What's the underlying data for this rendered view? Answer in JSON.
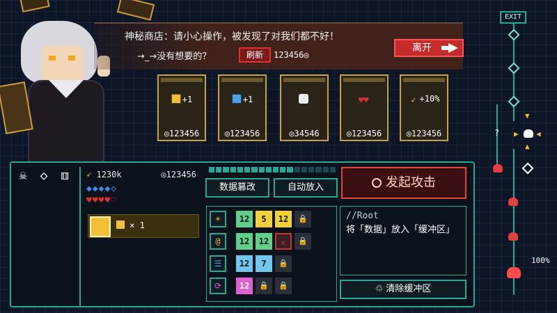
{
  "shop": {
    "message": "神秘商店：请小心操作，被发现了对我们都不好！",
    "subtitle": "→_→没有想要的？",
    "refresh_label": "刷新",
    "refresh_cost": "123456◎",
    "leave_label": "离开"
  },
  "cards": [
    {
      "effect": "+1",
      "icon": "yellow-chip-icon",
      "price": "◎123456"
    },
    {
      "effect": "+1",
      "icon": "blue-chip-icon",
      "price": "◎123456"
    },
    {
      "effect": "",
      "icon": "dice-icon",
      "price": "◎34546"
    },
    {
      "effect": "♥♥",
      "icon": "heart-icon",
      "price": "◎123456"
    },
    {
      "effect": "+10%",
      "icon": "sword-icon",
      "price": "◎123456"
    }
  ],
  "player": {
    "attack": "1230k",
    "coins": "◎123456",
    "shields": "◆◆◆◆◇",
    "hearts": "♥♥♥♥♡",
    "item_count": "× 1"
  },
  "actions": {
    "tamper_label": "数据篡改",
    "auto_label": "自动放入",
    "attack_label": "发起攻击",
    "clear_label": "清除缓冲区"
  },
  "grid": {
    "rows": [
      {
        "icon": "☀",
        "cells": [
          "12",
          "5",
          "12"
        ]
      },
      {
        "icon": "@",
        "cells": [
          "12",
          "12",
          "✕"
        ]
      },
      {
        "icon": "☰",
        "cells": [
          "12",
          "7"
        ]
      },
      {
        "icon": "⟳",
        "cells": [
          "12"
        ]
      }
    ]
  },
  "console": {
    "line1": "//Root",
    "line2": "将「数据」放入「缓冲区」"
  },
  "map": {
    "exit_label": "EXIT",
    "percent": "100%",
    "unknown": "?"
  },
  "progress": {
    "filled": 12,
    "total": 18
  }
}
